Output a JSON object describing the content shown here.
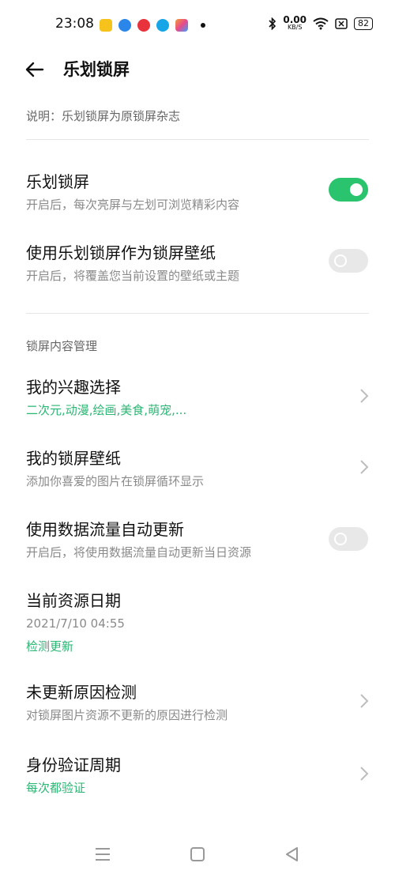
{
  "status_bar": {
    "time": "23:08",
    "net_speed_value": "0.00",
    "net_speed_unit": "KB/S",
    "battery": "82",
    "app_icons": [
      {
        "name": "notes-app-icon",
        "color": "#f6c21c"
      },
      {
        "name": "browser-app-icon",
        "color": "#2a86e8"
      },
      {
        "name": "video-app-icon",
        "color": "#e8323c"
      },
      {
        "name": "qq-app-icon",
        "color": "#16a6e8"
      },
      {
        "name": "photos-app-icon",
        "color": "#f39c32"
      }
    ]
  },
  "header": {
    "title": "乐划锁屏"
  },
  "description": "说明：乐划锁屏为原锁屏杂志",
  "settings": {
    "lock_screen": {
      "title": "乐划锁屏",
      "subtitle": "开启后，每次亮屏与左划可浏览精彩内容",
      "enabled": true
    },
    "use_as_wallpaper": {
      "title": "使用乐划锁屏作为锁屏壁纸",
      "subtitle": "开启后，将覆盖您当前设置的壁纸或主题",
      "enabled": false
    }
  },
  "section_title": "锁屏内容管理",
  "content": {
    "interests": {
      "title": "我的兴趣选择",
      "subtitle": "二次元,动漫,绘画,美食,萌宠,..."
    },
    "wallpaper": {
      "title": "我的锁屏壁纸",
      "subtitle": "添加你喜爱的图片在锁屏循环显示"
    },
    "data_update": {
      "title": "使用数据流量自动更新",
      "subtitle": "开启后，将使用数据流量自动更新当日资源",
      "enabled": false
    },
    "resource_date": {
      "title": "当前资源日期",
      "date": "2021/7/10 04:55",
      "action": "检测更新"
    },
    "no_update_check": {
      "title": "未更新原因检测",
      "subtitle": "对锁屏图片资源不更新的原因进行检测"
    },
    "verify_period": {
      "title": "身份验证周期",
      "subtitle": "每次都验证"
    }
  },
  "colors": {
    "accent": "#2bc46e",
    "accent_text": "#2bb673"
  }
}
